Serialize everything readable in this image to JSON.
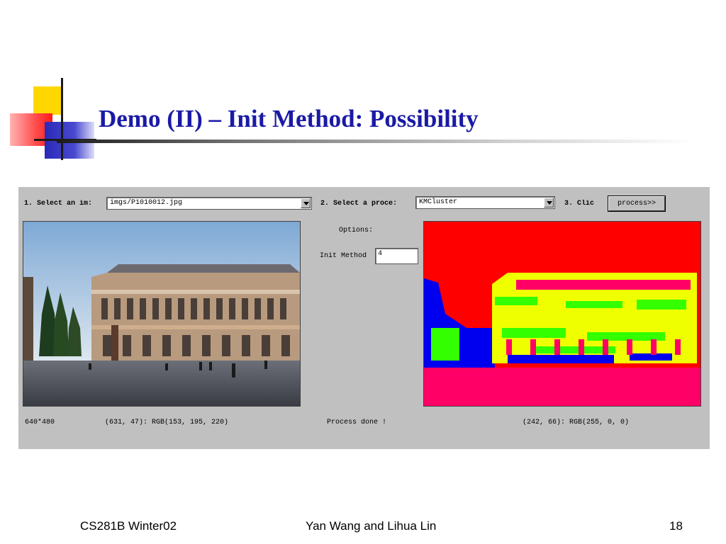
{
  "slide": {
    "title": "Demo (II) – Init Method: Possibility",
    "footer_left": "CS281B Winter02",
    "footer_center": "Yan Wang and Lihua Lin",
    "footer_right": "18"
  },
  "app": {
    "step1_label": "1. Select an im:",
    "image_select_value": "imgs/P1010012.jpg",
    "step2_label": "2. Select a proce:",
    "process_select_value": "KMCluster",
    "step3_label": "3. Clic",
    "process_button_label": "process>>",
    "options_label": "Options:",
    "init_method_label": "Init Method",
    "init_method_value": "4",
    "image_size": "640*480",
    "source_pixel_info": "(631, 47): RGB(153, 195, 220)",
    "status_text": "Process done !",
    "result_pixel_info": "(242, 66): RGB(255, 0, 0)"
  },
  "colors": {
    "title": "#1a1aa6",
    "panel_bg": "#c0c0c0",
    "cluster_red": "#ff0000",
    "cluster_pink": "#ff0066",
    "cluster_yellow": "#f0ff00",
    "cluster_green": "#33ff00",
    "cluster_blue": "#0000ee"
  }
}
